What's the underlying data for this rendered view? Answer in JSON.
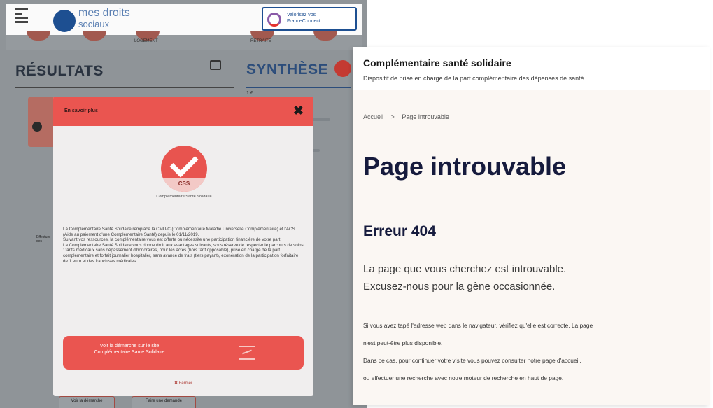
{
  "left": {
    "header": {
      "logo_text_line1": "mes droits",
      "logo_text_line2": "sociaux",
      "fc_button_label": "Valorisez vos FranceConnect"
    },
    "nav": {
      "item1": "LOGEMENT",
      "item2": "RETRAITE"
    },
    "results_title": "RÉSULTATS",
    "synthesis_title": "SYNTHÈSE",
    "side_text": "1 €",
    "bg_left_label": "Effectuer des",
    "bottom_buttons": [
      "Voir la démarche",
      "Faire une demande"
    ],
    "modal": {
      "title": "En savoir plus",
      "close": "✖",
      "logo_abbr": "CSS",
      "logo_name": "Complémentaire Santé Solidaire",
      "body_p1": "La Complémentaire Santé Solidaire remplace la CMU-C (Complémentaire Maladie Universelle Complémentaire) et l'ACS (Aide au paiement d'une Complémentaire Santé) depuis le 01/11/2019.",
      "body_p2": "Suivant vos ressources, la complémentaire vous est offerte ou nécessite une participation financière de votre part.",
      "body_p3": "La Complémentaire Santé Solidaire vous donne droit aux avantages suivants, sous réserve de respecter le parcours de soins : tarifs médicaux sans dépassement d'honoraires, pour les actes (hors tarif opposable), prise en charge de la part complémentaire et forfait journalier hospitalier, sans avance de frais (tiers payant), exonération de la participation forfaitaire de 1 euro et des franchises médicales.",
      "cta_label": "Voir la démarche sur le site Complémentaire Santé Solidaire",
      "footer": "✖ Fermer"
    }
  },
  "right": {
    "site_title": "Complémentaire santé solidaire",
    "site_subtitle": "Dispositif de prise en charge de la part complémentaire des dépenses de santé",
    "breadcrumb_home": "Accueil",
    "breadcrumb_sep": ">",
    "breadcrumb_current": "Page introuvable",
    "h1": "Page introuvable",
    "h2": "Erreur 404",
    "lead_line1": "La page que vous cherchez est introuvable.",
    "lead_line2": "Excusez-nous pour la gène occasionnée.",
    "text_line1": "Si vous avez tapé l'adresse web dans le navigateur, vérifiez qu'elle est correcte. La page",
    "text_line2": "n'est peut-être plus disponible.",
    "text_line3": "Dans ce cas, pour continuer votre visite vous pouvez consulter notre page d'accueil,",
    "text_line4": "ou effectuer une recherche avec notre moteur de recherche en haut de page."
  },
  "colors": {
    "modal_accent": "#ea5550",
    "dark_title": "#161b3d",
    "overlay": "#8f9498"
  }
}
